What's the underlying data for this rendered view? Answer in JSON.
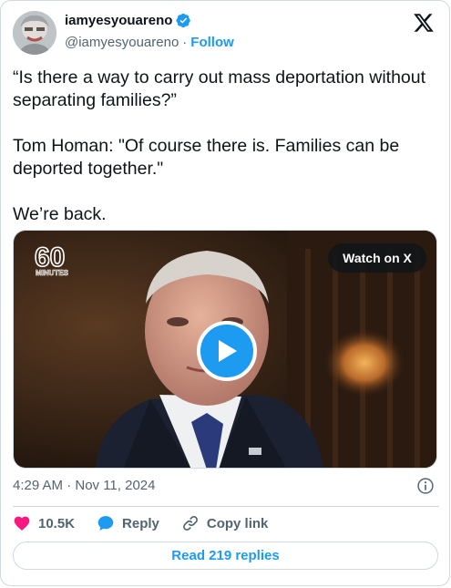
{
  "author": {
    "display_name": "iamyesyouareno",
    "handle": "@iamyesyouareno",
    "separator": "·",
    "follow_label": "Follow"
  },
  "tweet": {
    "text": "“Is there a way to carry out mass deportation without separating families?”\n\nTom Homan: \"Of course there is. Families can be deported together.\"\n\nWe’re back."
  },
  "media": {
    "logo_number": "60",
    "logo_word": "MINUTES",
    "watch_label": "Watch on X"
  },
  "timestamp": "4:29 AM · Nov 11, 2024",
  "actions": {
    "like_count": "10.5K",
    "reply_label": "Reply",
    "copy_link_label": "Copy link"
  },
  "read_replies_label": "Read 219 replies",
  "colors": {
    "accent": "#1d9bf0",
    "like": "#f91880",
    "muted": "#536471",
    "border": "#cfd9de"
  },
  "icons": [
    "verified-badge-icon",
    "x-logo-icon",
    "play-icon",
    "info-icon",
    "heart-icon",
    "reply-bubble-icon",
    "link-icon"
  ]
}
